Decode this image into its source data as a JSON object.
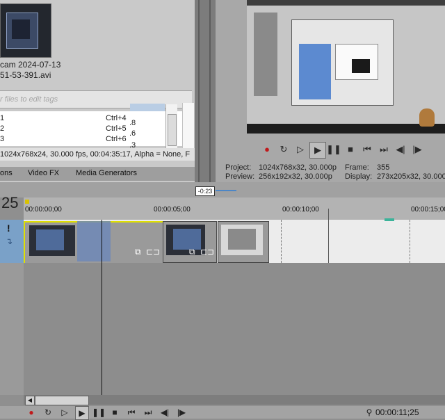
{
  "media": {
    "filename_line1": "cam 2024-07-13",
    "filename_line2": "51-53-391.avi",
    "tags_placeholder": "r files to edit tags",
    "shortcuts": [
      {
        "key": "1",
        "shortcut": "Ctrl+4"
      },
      {
        "key": "2",
        "shortcut": "Ctrl+5"
      },
      {
        "key": "3",
        "shortcut": "Ctrl+6"
      }
    ],
    "side_numbers": [
      ".8",
      ".6",
      ".3"
    ],
    "info": "1024x768x24, 30.000 fps, 00:04:35:17, Alpha = None, F",
    "tabs": [
      "ons",
      "Video FX",
      "Media Generators"
    ]
  },
  "preview": {
    "project_label": "Project:",
    "project_value": "1024x768x32, 30.000p",
    "preview_label": "Preview:",
    "preview_value": "256x192x32, 30.000p",
    "frame_label": "Frame:",
    "frame_value": "355",
    "display_label": "Display:",
    "display_value": "273x205x32, 30.000"
  },
  "timeline": {
    "track_number": "25",
    "cursor_time": "-0:23",
    "ruler": [
      "00:00:00;00",
      "00:00:05;00",
      "00:00:10;00",
      "00:00:15;00"
    ],
    "current_time": "00:00:11;25"
  },
  "icons": {
    "record": "record-icon",
    "loop": "loop-icon",
    "play_from_start": "play-from-start-icon",
    "play": "play-icon",
    "pause": "pause-icon",
    "stop": "stop-icon",
    "prev": "go-to-start-icon",
    "next": "go-to-end-icon",
    "prev_frame": "prev-frame-icon",
    "next_frame": "next-frame-icon"
  },
  "colors": {
    "selection": "#7aa1c8",
    "clip_highlight": "#e0e000",
    "record": "#c0191b"
  }
}
